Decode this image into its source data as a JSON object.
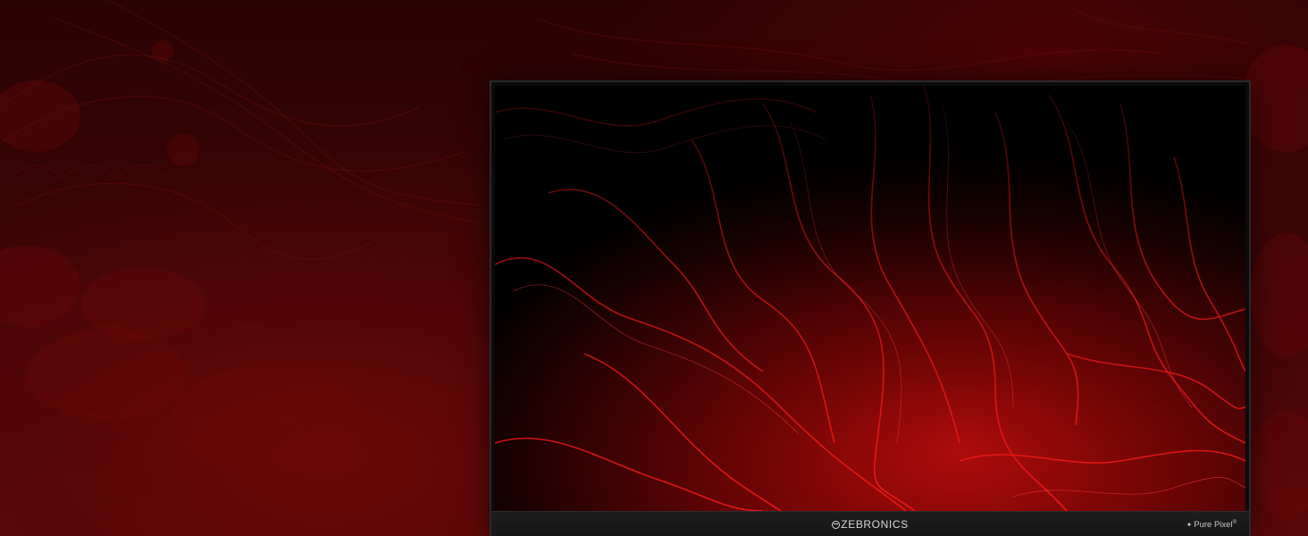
{
  "monitor": {
    "brand_text": "ZEBRONICS",
    "badge_text": "Pure Pixel",
    "badge_mark": "®",
    "badge_icon": "sparkle-icon"
  },
  "colors": {
    "background": "#3c0505",
    "accent_red": "#e01010",
    "bezel": "#1d1d1f"
  }
}
